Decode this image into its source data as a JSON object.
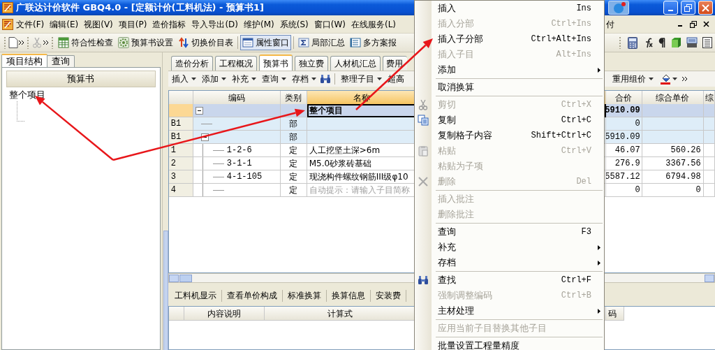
{
  "window": {
    "title": "广联达计价软件 GBQ4.0 - [定额计价(工料机法) - 预算书1]"
  },
  "menu_bar": {
    "items": [
      "文件(F)",
      "编辑(E)",
      "视图(V)",
      "项目(P)",
      "造价指标",
      "导入导出(D)",
      "维护(M)",
      "系统(S)",
      "窗口(W)",
      "在线服务(L)"
    ],
    "right_item": "付"
  },
  "toolbar": {
    "buttons": [
      {
        "label": "符合性检查",
        "pressed": false
      },
      {
        "label": "预算书设置",
        "pressed": false
      },
      {
        "label": "切换价目表",
        "pressed": false
      },
      {
        "label": "属性窗口",
        "pressed": true
      },
      {
        "label": "局部汇总",
        "pressed": false
      },
      {
        "label": "多方案报",
        "pressed": false
      }
    ]
  },
  "left_panel": {
    "tabs": [
      {
        "label": "项目结构",
        "selected": true
      },
      {
        "label": "查询",
        "selected": false
      }
    ],
    "header": "预算书",
    "tree": [
      {
        "label": "整个项目"
      }
    ]
  },
  "doc_tabs": [
    {
      "label": "造价分析",
      "selected": false
    },
    {
      "label": "工程概况",
      "selected": false
    },
    {
      "label": "预算书",
      "selected": true
    },
    {
      "label": "独立费",
      "selected": false
    },
    {
      "label": "人材机汇总",
      "selected": false
    },
    {
      "label": "费用"
    }
  ],
  "doc_toolbar": {
    "left": [
      {
        "label": "插入",
        "dropdown": true
      },
      {
        "label": "添加",
        "dropdown": true
      },
      {
        "label": "补充",
        "dropdown": true
      },
      {
        "label": "查询",
        "dropdown": true
      },
      {
        "label": "存档",
        "dropdown": true
      },
      {
        "kind": "find"
      },
      {
        "label": "整理子目",
        "dropdown": true
      },
      {
        "label": "超高",
        "dropdown": false
      }
    ],
    "right": [
      {
        "label": "重用组价",
        "dropdown": true
      },
      {
        "kind": "paint"
      }
    ]
  },
  "table": {
    "columns": [
      "编码",
      "类别",
      "名称",
      "合价",
      "综合单价",
      "综"
    ],
    "rows": [
      {
        "kind": "project",
        "name": "整个项目",
        "total": "5910.09",
        "expanded": true,
        "selected": true
      },
      {
        "kind": "division",
        "number": "B1",
        "type": "部",
        "total": "0",
        "selected": false
      },
      {
        "kind": "division",
        "number": "B1",
        "type": "部",
        "total": "5910.09",
        "expanded": true,
        "selected": false
      },
      {
        "kind": "item",
        "number": "1",
        "code": "1-2-6",
        "type": "定",
        "name": "人工挖坚土深>6m",
        "total": "46.07",
        "unit_price": "560.26",
        "selected": false
      },
      {
        "kind": "item",
        "number": "2",
        "code": "3-1-1",
        "type": "定",
        "name": "M5.0砂浆砖基础",
        "total": "276.9",
        "unit_price": "3367.56",
        "selected": false
      },
      {
        "kind": "item",
        "number": "3",
        "code": "4-1-105",
        "type": "定",
        "name": "现浇构件螺纹钢筋III级φ10",
        "total": "5587.12",
        "unit_price": "6794.98",
        "selected": false
      },
      {
        "kind": "hint",
        "number": "4",
        "type": "定",
        "name": "自动提示：请输入子目简称",
        "total": "0",
        "unit_price": "0",
        "selected": false
      }
    ]
  },
  "bottom_tabs": [
    "工料机显示",
    "查看单价构成",
    "标准换算",
    "换算信息",
    "安装费"
  ],
  "bottom_table": {
    "columns": [
      "内容说明",
      "计算式",
      "码"
    ]
  },
  "context_menu": {
    "items": [
      {
        "kind": "item",
        "label": "插入",
        "shortcut": "Ins",
        "disabled": false
      },
      {
        "kind": "item",
        "label": "插入分部",
        "shortcut": "Ctrl+Ins",
        "disabled": true
      },
      {
        "kind": "item",
        "label": "插入子分部",
        "shortcut": "Ctrl+Alt+Ins",
        "disabled": false
      },
      {
        "kind": "item",
        "label": "插入子目",
        "shortcut": "Alt+Ins",
        "disabled": true
      },
      {
        "kind": "item",
        "label": "添加",
        "submenu": true,
        "disabled": false
      },
      {
        "kind": "separator"
      },
      {
        "kind": "item",
        "label": "取消换算",
        "disabled": false
      },
      {
        "kind": "separator"
      },
      {
        "kind": "item",
        "label": "剪切",
        "shortcut": "Ctrl+X",
        "disabled": true
      },
      {
        "kind": "item",
        "label": "复制",
        "shortcut": "Ctrl+C",
        "disabled": false
      },
      {
        "kind": "item",
        "label": "复制格子内容",
        "shortcut": "Shift+Ctrl+C",
        "disabled": false
      },
      {
        "kind": "item",
        "label": "粘贴",
        "shortcut": "Ctrl+V",
        "disabled": true
      },
      {
        "kind": "item",
        "label": "粘贴为子项",
        "disabled": true
      },
      {
        "kind": "item",
        "label": "删除",
        "shortcut": "Del",
        "disabled": true
      },
      {
        "kind": "separator"
      },
      {
        "kind": "item",
        "label": "插入批注",
        "disabled": true
      },
      {
        "kind": "item",
        "label": "删除批注",
        "disabled": true
      },
      {
        "kind": "separator"
      },
      {
        "kind": "item",
        "label": "查询",
        "shortcut": "F3",
        "disabled": false
      },
      {
        "kind": "item",
        "label": "补充",
        "submenu": true,
        "disabled": false
      },
      {
        "kind": "item",
        "label": "存档",
        "submenu": true,
        "disabled": false
      },
      {
        "kind": "separator"
      },
      {
        "kind": "item",
        "label": "查找",
        "shortcut": "Ctrl+F",
        "disabled": false
      },
      {
        "kind": "item",
        "label": "强制调整编码",
        "shortcut": "Ctrl+B",
        "disabled": true
      },
      {
        "kind": "item",
        "label": "主材处理",
        "submenu": true,
        "disabled": false
      },
      {
        "kind": "separator"
      },
      {
        "kind": "item",
        "label": "应用当前子目替换其他子目",
        "disabled": true
      },
      {
        "kind": "separator"
      },
      {
        "kind": "item",
        "label": "批量设置工程量精度",
        "disabled": false
      }
    ]
  }
}
